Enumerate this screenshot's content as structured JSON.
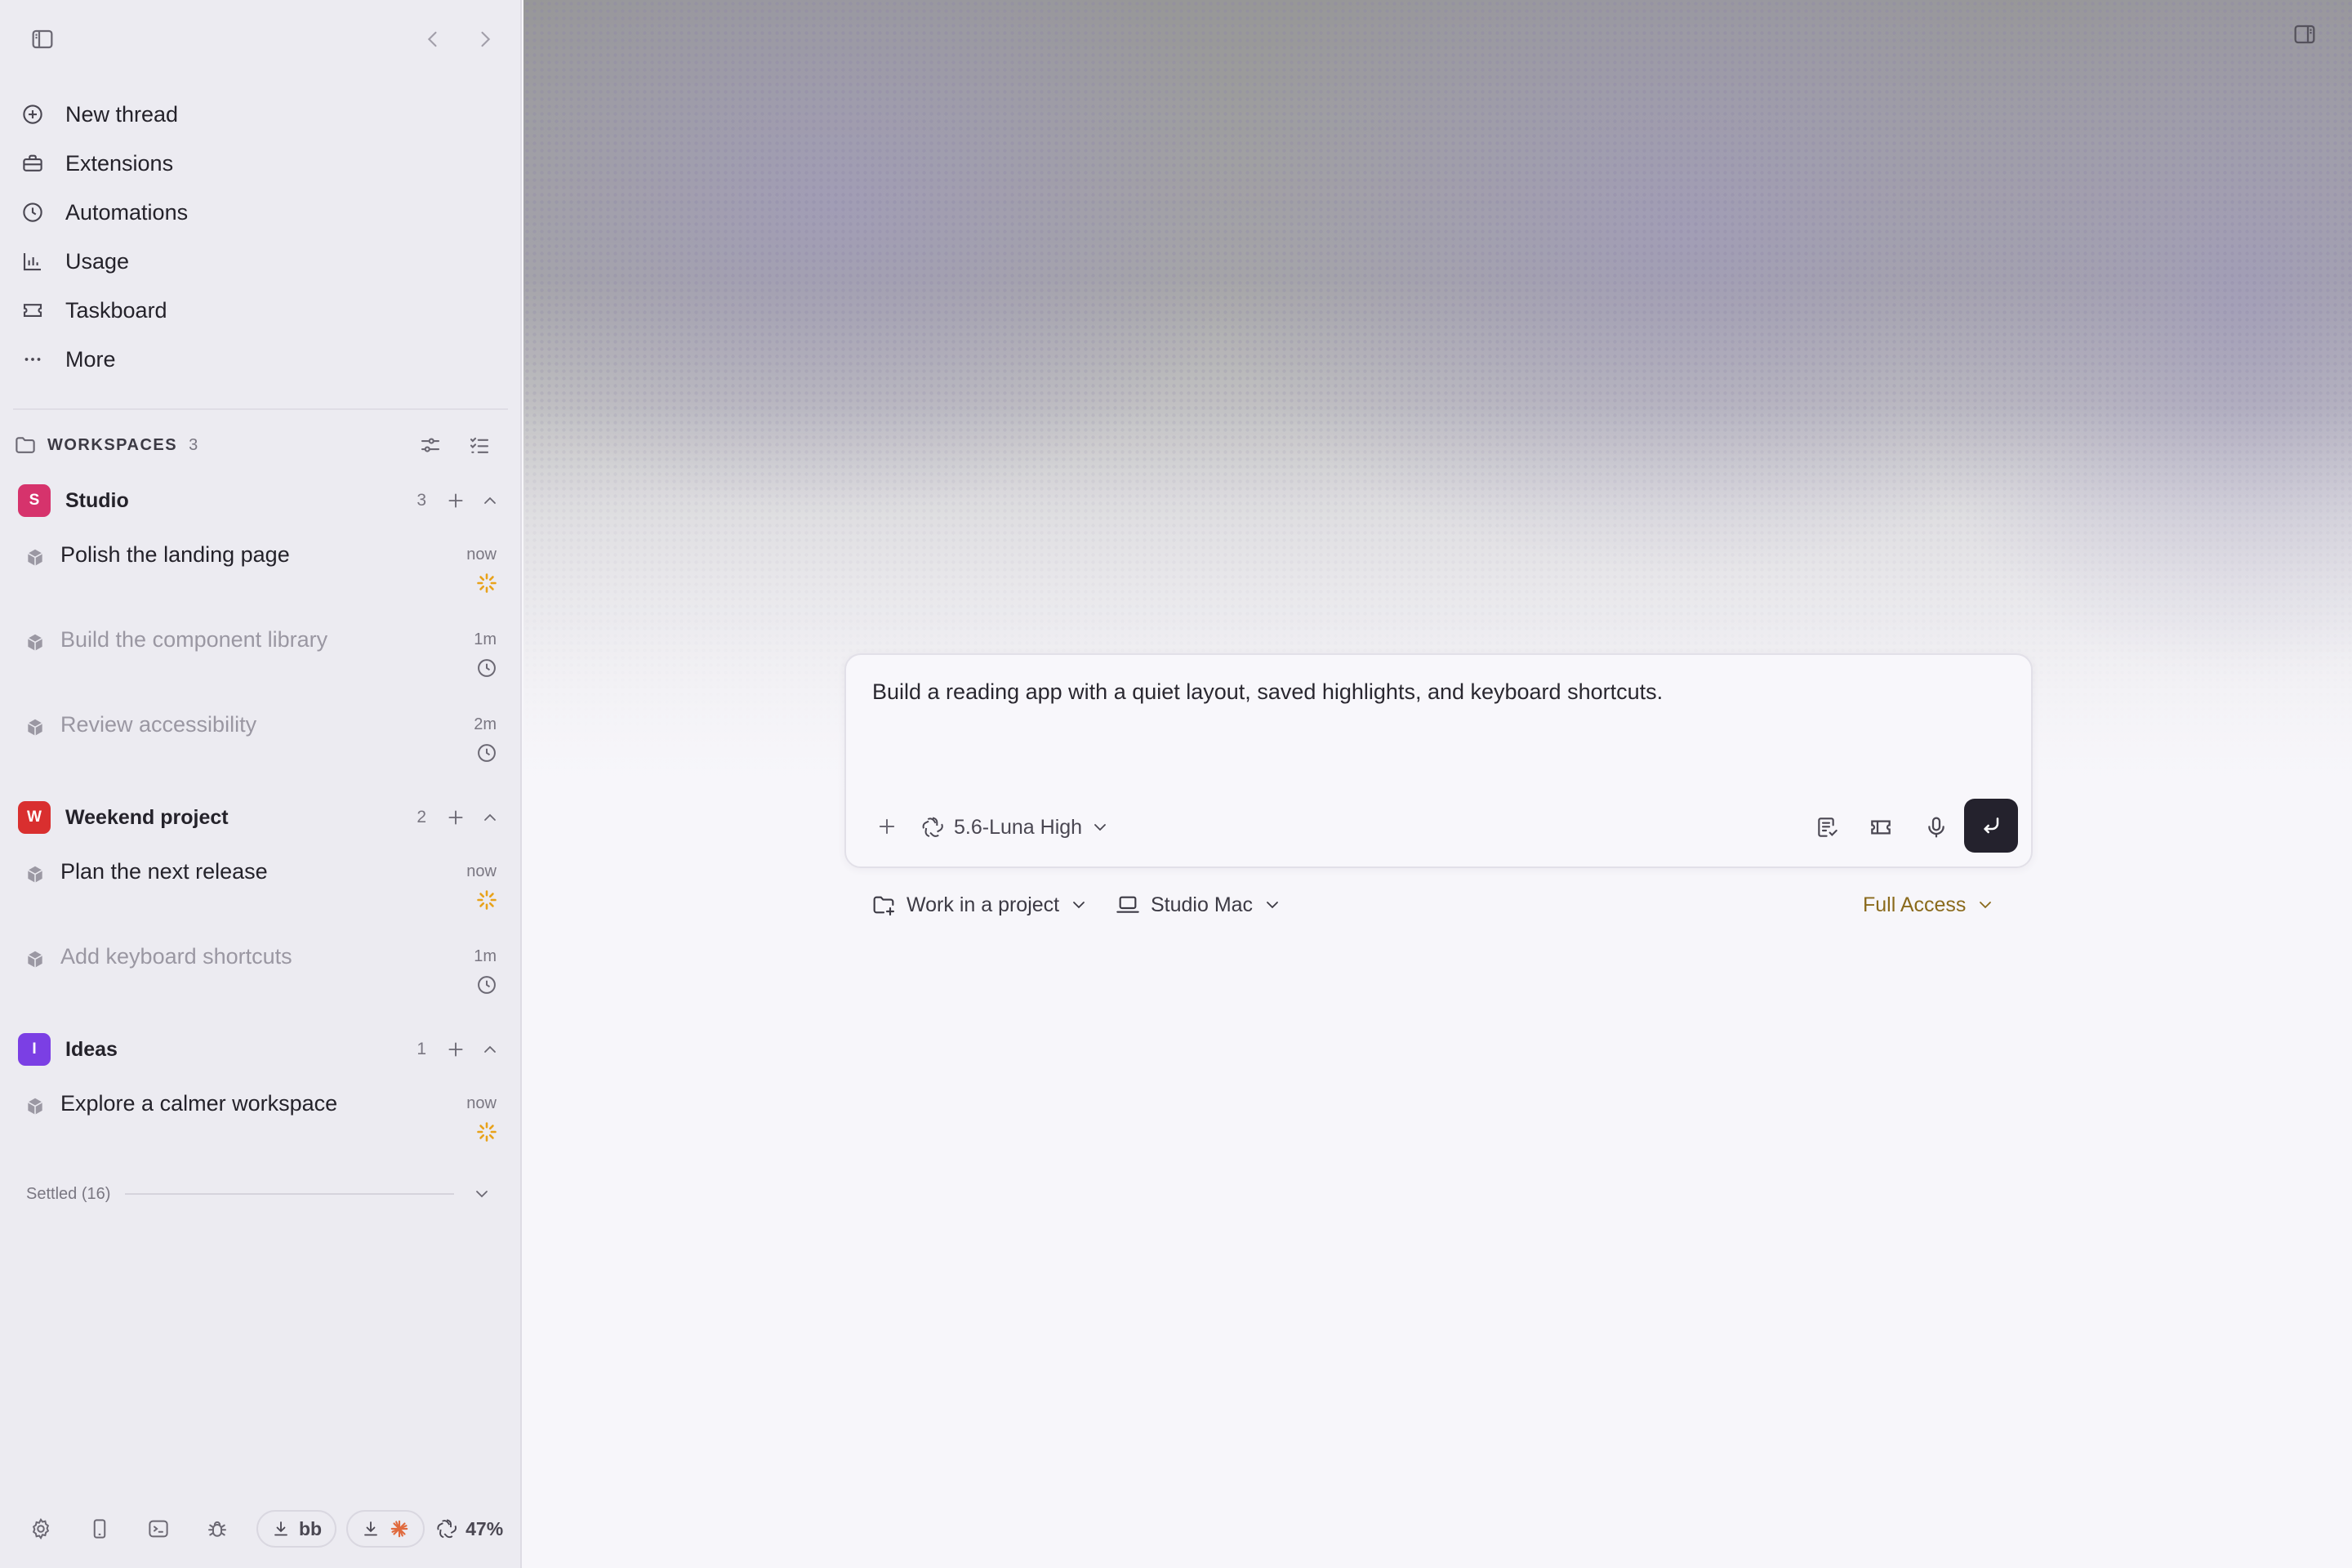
{
  "sidebar": {
    "nav": [
      {
        "label": "New thread",
        "icon": "plus-circle-icon"
      },
      {
        "label": "Extensions",
        "icon": "toolbox-icon"
      },
      {
        "label": "Automations",
        "icon": "clock-icon"
      },
      {
        "label": "Usage",
        "icon": "bar-chart-icon"
      },
      {
        "label": "Taskboard",
        "icon": "ticket-icon"
      },
      {
        "label": "More",
        "icon": "more-dots-icon"
      }
    ],
    "workspaces": {
      "label": "WORKSPACES",
      "count": "3",
      "groups": [
        {
          "name": "Studio",
          "letter": "S",
          "color": "#d6336c",
          "count": "3",
          "threads": [
            {
              "title": "Polish the landing page",
              "time": "now",
              "status": "running"
            },
            {
              "title": "Build the component library",
              "time": "1m",
              "status": "scheduled"
            },
            {
              "title": "Review accessibility",
              "time": "2m",
              "status": "scheduled"
            }
          ]
        },
        {
          "name": "Weekend project",
          "letter": "W",
          "color": "#d92f2f",
          "count": "2",
          "threads": [
            {
              "title": "Plan the next release",
              "time": "now",
              "status": "running"
            },
            {
              "title": "Add keyboard shortcuts",
              "time": "1m",
              "status": "scheduled"
            }
          ]
        },
        {
          "name": "Ideas",
          "letter": "I",
          "color": "#7b3fe4",
          "count": "1",
          "threads": [
            {
              "title": "Explore a calmer workspace",
              "time": "now",
              "status": "running"
            }
          ]
        }
      ]
    },
    "settled_label": "Settled (16)",
    "footer": {
      "download_chip_label": "bb",
      "usage_percent": "47%"
    }
  },
  "composer": {
    "prompt_text": "Build a reading app with a quiet layout, saved highlights, and keyboard shortcuts.",
    "model_label": "5.6-Luna High"
  },
  "context_bar": {
    "project_label": "Work in a project",
    "device_label": "Studio Mac",
    "access_label": "Full Access"
  },
  "colors": {
    "running": "#e8a21a",
    "access_warning": "#8a6a1c",
    "send_button": "#24222d"
  }
}
